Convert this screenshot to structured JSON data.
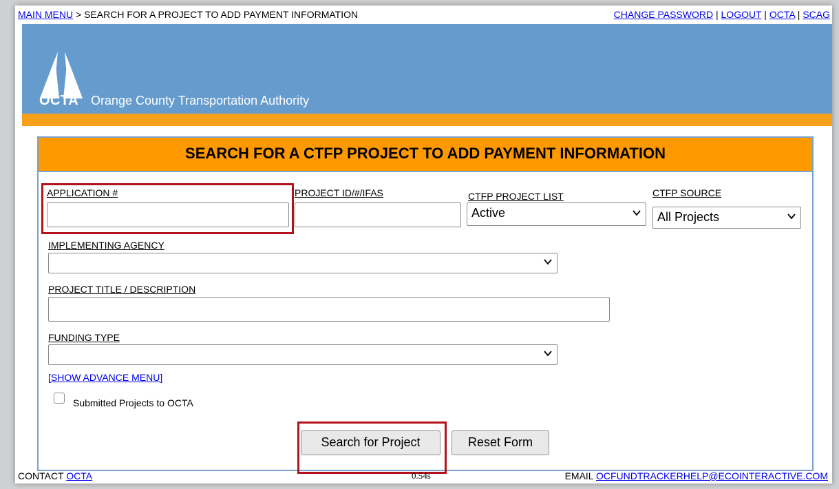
{
  "breadcrumb": {
    "main_menu": "MAIN MENU",
    "current": " > SEARCH FOR A PROJECT TO ADD PAYMENT INFORMATION"
  },
  "top_links": {
    "change_password": "CHANGE PASSWORD",
    "logout": "LOGOUT",
    "octa": "OCTA",
    "scag": "SCAG",
    "separator": " | "
  },
  "brand": {
    "short": "OCTA",
    "full": "Orange County Transportation Authority",
    "banner_color": "#659bcd",
    "accent_color": "#f7a11a"
  },
  "panel": {
    "title": "SEARCH FOR A CTFP PROJECT TO ADD PAYMENT INFORMATION",
    "title_bg": "#ff9900"
  },
  "fields": {
    "application": {
      "label": "APPLICATION #",
      "value": ""
    },
    "project_id": {
      "label": "PROJECT ID/#/IFAS",
      "value": ""
    },
    "ctfp_project_list": {
      "label": "CTFP PROJECT LIST",
      "selected": "Active"
    },
    "ctfp_source": {
      "label": "CTFP SOURCE",
      "selected": "All Projects"
    },
    "implementing_agency": {
      "label": "IMPLEMENTING AGENCY",
      "selected": ""
    },
    "project_title": {
      "label": "PROJECT TITLE / DESCRIPTION",
      "value": ""
    },
    "funding_type": {
      "label": "FUNDING TYPE",
      "selected": ""
    }
  },
  "advance_menu": "[SHOW ADVANCE MENU]",
  "submitted_checkbox": {
    "label": "Submitted Projects to OCTA",
    "checked": false
  },
  "buttons": {
    "search": "Search for Project",
    "reset": "Reset Form"
  },
  "highlight_color": "#b3121d",
  "footer": {
    "contact_prefix": "CONTACT ",
    "contact_link": "OCTA",
    "timing": "0.54s",
    "email_prefix": "EMAIL ",
    "email_link": "OCFUNDTRACKERHELP@ECOINTERACTIVE.COM"
  }
}
